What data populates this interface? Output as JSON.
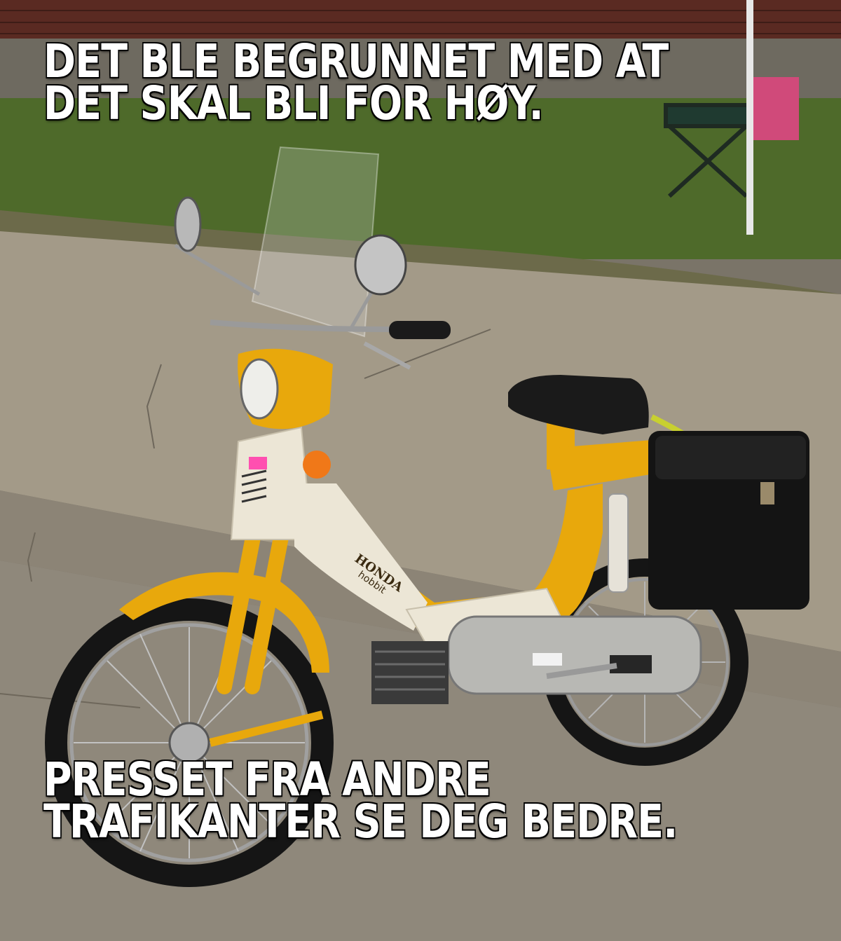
{
  "caption_top": {
    "line1": "DET BLE BEGRUNNET MED AT",
    "line2": "DET SKAL BLI FOR HØY."
  },
  "caption_bottom": {
    "line1": "PRESSET FRA ANDRE",
    "line2": "TRAFIKANTER SE DEG BEDRE."
  },
  "moped": {
    "brand_badge": "HONDA",
    "model_badge": "hobbit",
    "body_color": "#e8a80c",
    "panel_color": "#ece6d6"
  },
  "colors": {
    "brick": "#5a2a22",
    "grass": "#4e6a2a",
    "sidewalk": "#a39a88",
    "street": "#8f887b",
    "text": "#ffffff"
  }
}
